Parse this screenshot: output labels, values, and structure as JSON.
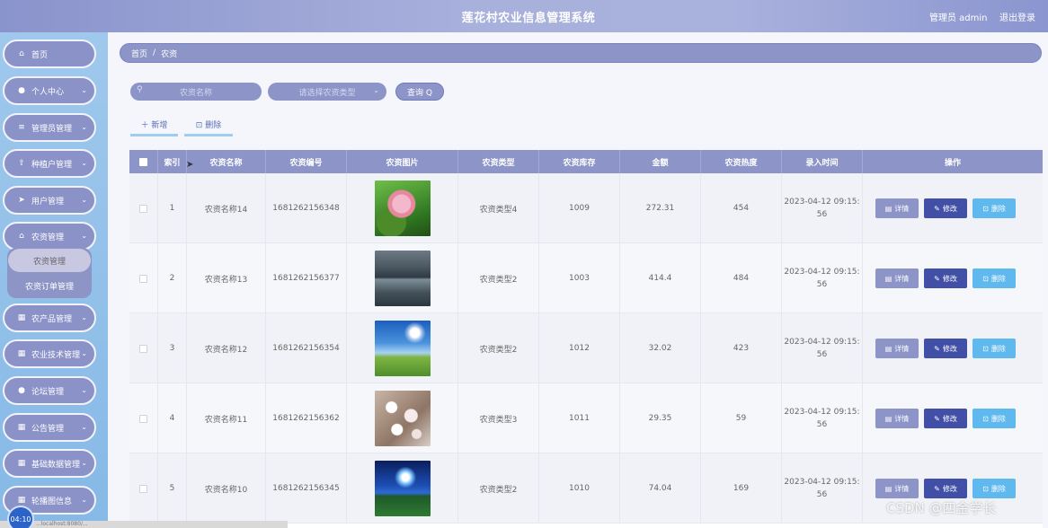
{
  "header": {
    "title": "莲花村农业信息管理系统",
    "admin_label": "管理员 admin",
    "logout_label": "退出登录"
  },
  "sidebar": {
    "items": [
      {
        "label": "首页",
        "icon": "home-icon",
        "glyph": "⌂"
      },
      {
        "label": "个人中心",
        "icon": "user-icon",
        "glyph": "●"
      },
      {
        "label": "管理员管理",
        "icon": "list-icon",
        "glyph": "≡"
      },
      {
        "label": "种植户管理",
        "icon": "upload-icon",
        "glyph": "⇪"
      },
      {
        "label": "用户管理",
        "icon": "send-icon",
        "glyph": "➤"
      },
      {
        "label": "农资管理",
        "icon": "shop-icon",
        "glyph": "⌂"
      },
      {
        "label": "农产品管理",
        "icon": "grid-icon",
        "glyph": "▦"
      },
      {
        "label": "农业技术管理",
        "icon": "grid-icon",
        "glyph": "▦"
      },
      {
        "label": "论坛管理",
        "icon": "user-icon",
        "glyph": "●"
      },
      {
        "label": "公告管理",
        "icon": "grid-icon",
        "glyph": "▦"
      },
      {
        "label": "基础数据管理",
        "icon": "grid-icon",
        "glyph": "▦"
      },
      {
        "label": "轮播图信息",
        "icon": "grid-icon",
        "glyph": "▦"
      }
    ],
    "submenu": [
      {
        "label": "农资管理"
      },
      {
        "label": "农资订单管理"
      }
    ]
  },
  "breadcrumb": {
    "home": "首页",
    "separator": "/",
    "current": "农资"
  },
  "search": {
    "name_placeholder": "农资名称",
    "type_placeholder": "请选择农资类型",
    "query_label": "查询 Q"
  },
  "actions": {
    "add_label": "＋ 新增",
    "delete_label": "⊡ 删除"
  },
  "table": {
    "columns": [
      "索引",
      "农资名称",
      "农资编号",
      "农资图片",
      "农资类型",
      "农资库存",
      "金额",
      "农资热度",
      "录入时间",
      "操作"
    ],
    "rows": [
      {
        "index": "1",
        "name": "农资名称14",
        "code": "1681262156348",
        "image": "lotus",
        "type": "农资类型4",
        "stock": "1009",
        "amount": "272.31",
        "heat": "454",
        "time_date": "2023-04-12 09:15:",
        "time_sec": "56"
      },
      {
        "index": "2",
        "name": "农资名称13",
        "code": "1681262156377",
        "image": "lake",
        "type": "农资类型2",
        "stock": "1003",
        "amount": "414.4",
        "heat": "484",
        "time_date": "2023-04-12 09:15:",
        "time_sec": "56"
      },
      {
        "index": "3",
        "name": "农资名称12",
        "code": "1681262156354",
        "image": "sky",
        "type": "农资类型2",
        "stock": "1012",
        "amount": "32.02",
        "heat": "423",
        "time_date": "2023-04-12 09:15:",
        "time_sec": "56"
      },
      {
        "index": "4",
        "name": "农资名称11",
        "code": "1681262156362",
        "image": "blossom",
        "type": "农资类型3",
        "stock": "1011",
        "amount": "29.35",
        "heat": "59",
        "time_date": "2023-04-12 09:15:",
        "time_sec": "56"
      },
      {
        "index": "5",
        "name": "农资名称10",
        "code": "1681262156345",
        "image": "night",
        "type": "农资类型2",
        "stock": "1010",
        "amount": "74.04",
        "heat": "169",
        "time_date": "2023-04-12 09:15:",
        "time_sec": "56"
      }
    ],
    "op_labels": {
      "detail": "详情",
      "edit": "修改",
      "delete": "删除"
    }
  },
  "overlay": {
    "watermark": "CSDN @四金学长",
    "timer": "04:10",
    "status_text": "...localhost:8080/..."
  },
  "colors": {
    "accent": "#8d94c8",
    "edit_button": "#4150a6",
    "delete_button": "#5fb8ee",
    "sidebar_bg": "#9fc8ec"
  }
}
